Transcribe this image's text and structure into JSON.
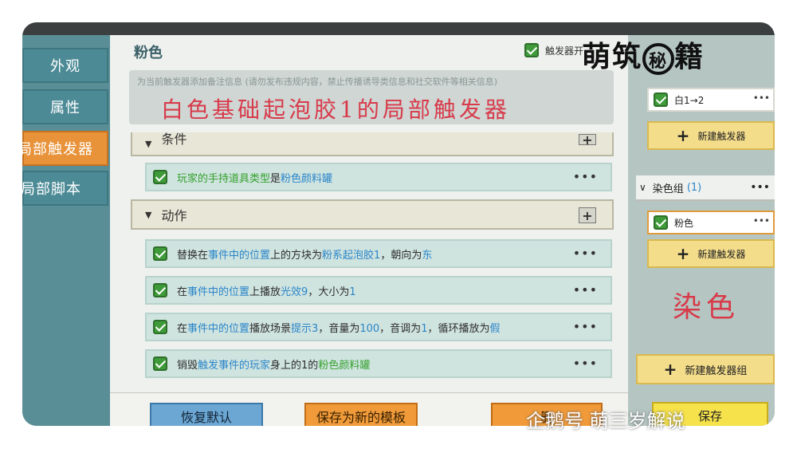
{
  "sidebar": {
    "items": [
      {
        "label": "外观"
      },
      {
        "label": "属性"
      },
      {
        "label": "局部触发器",
        "active": true
      },
      {
        "label": "局部脚本"
      }
    ]
  },
  "main": {
    "title": "粉色",
    "trigger_toggle_label": "触发器开",
    "note_placeholder": "为当前触发器添加备注信息 (请勿发布违规内容，禁止传播诱导类信息和社交软件等相关信息)",
    "handwritten_note": "白色基础起泡胶1的局部触发器",
    "condition_section": {
      "label": "条件",
      "rows": [
        {
          "parts": [
            {
              "t": "玩家的手持道具类型",
              "c": "g"
            },
            {
              "t": "是",
              "c": ""
            },
            {
              "t": "粉色颜料罐",
              "c": "b"
            }
          ]
        }
      ]
    },
    "action_section": {
      "label": "动作",
      "rows": [
        {
          "parts": [
            {
              "t": "替换在",
              "c": ""
            },
            {
              "t": "事件中的位置",
              "c": "b"
            },
            {
              "t": "上的方块为",
              "c": ""
            },
            {
              "t": "粉系起泡胶1",
              "c": "b"
            },
            {
              "t": "，朝向为",
              "c": ""
            },
            {
              "t": "东",
              "c": "b"
            }
          ]
        },
        {
          "parts": [
            {
              "t": "在",
              "c": ""
            },
            {
              "t": "事件中的位置",
              "c": "b"
            },
            {
              "t": "上播放",
              "c": ""
            },
            {
              "t": "光效9",
              "c": "b"
            },
            {
              "t": "，大小为",
              "c": ""
            },
            {
              "t": "1",
              "c": "b"
            }
          ]
        },
        {
          "parts": [
            {
              "t": "在",
              "c": ""
            },
            {
              "t": "事件中的位置",
              "c": "b"
            },
            {
              "t": "播放场景",
              "c": ""
            },
            {
              "t": "提示3",
              "c": "b"
            },
            {
              "t": "，音量为",
              "c": ""
            },
            {
              "t": "100",
              "c": "b"
            },
            {
              "t": "，音调为",
              "c": ""
            },
            {
              "t": "1",
              "c": "b"
            },
            {
              "t": "，循环播放为",
              "c": ""
            },
            {
              "t": "假",
              "c": "b"
            }
          ]
        },
        {
          "parts": [
            {
              "t": "销毁",
              "c": ""
            },
            {
              "t": "触发事件的玩家",
              "c": "b"
            },
            {
              "t": "身上的1的",
              "c": ""
            },
            {
              "t": "粉色颜料罐",
              "c": "g"
            }
          ]
        }
      ]
    },
    "more_label": "•••",
    "buttons": {
      "restore": "恢复默认",
      "save_template": "保存为新的模板",
      "third": "删"
    }
  },
  "right": {
    "item1": "白1→2",
    "new_trigger": "新建触发器",
    "group_name": "染色组",
    "group_count": "(1)",
    "item2": "粉色",
    "dye_note": "染色",
    "new_group": "新建触发器组",
    "save": "保存"
  },
  "watermark": {
    "brand_left": "萌筑",
    "brand_seal": "秘",
    "brand_right": "籍",
    "bottom": "企鹅号 萌三岁解说"
  },
  "colors": {
    "green": "#34a22d",
    "blue": "#2b86c9",
    "orange": "#e8933a",
    "accent_red": "#d83a4a"
  }
}
